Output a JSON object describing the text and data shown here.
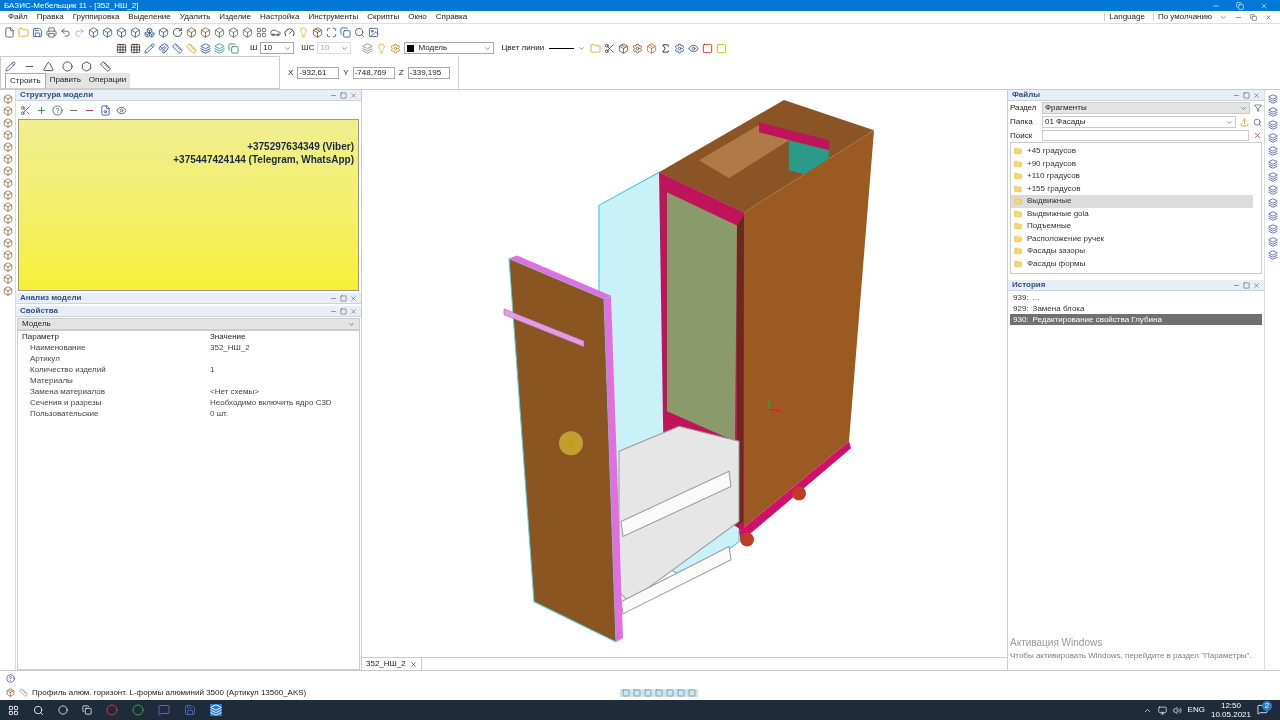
{
  "window": {
    "title": "БАЗИС-Мебельщик 11 - [352_НШ_2]"
  },
  "menu": [
    "Файл",
    "Правка",
    "Группировка",
    "Выделение",
    "Удалить",
    "Изделие",
    "Настройка",
    "Инструменты",
    "Скрипты",
    "Окно",
    "Справка"
  ],
  "menu_right": {
    "language": "Language",
    "profile": "По умолчанию"
  },
  "toolbar": {
    "width_label": "Ш",
    "width_value": "10",
    "ws_label": "ШС",
    "ws_value": "10",
    "ws_disabled": true,
    "layer": "Модель",
    "line_color_label": "Цвет линии"
  },
  "build_tabs": [
    {
      "label": "Строить",
      "selected": true
    },
    {
      "label": "Править",
      "selected": false
    },
    {
      "label": "Операции",
      "selected": false
    }
  ],
  "coords": [
    {
      "label": "X",
      "value": "-932,61"
    },
    {
      "label": "Y",
      "value": "-748,769"
    },
    {
      "label": "Z",
      "value": "-339,195"
    }
  ],
  "structure_panel": {
    "title": "Структура модели",
    "note_lines": [
      "+375297634349 (Viber)",
      "+375447424144 (Telegram, WhatsApp)"
    ]
  },
  "analysis_panel": {
    "title": "Анализ модели"
  },
  "properties": {
    "title": "Свойства",
    "object": "Модель",
    "columns": [
      "Параметр",
      "Значение"
    ],
    "rows": [
      {
        "name": "Наименование",
        "value": "352_НШ_2"
      },
      {
        "name": "Артикул"
      },
      {
        "name": "Количество изделий",
        "value": "1"
      },
      {
        "name": "Материалы"
      },
      {
        "name": "Замена материалов",
        "value": "<Нет схемы>"
      },
      {
        "name": "Сечения и разрезы",
        "value": "Необходимо включить ядро C3D"
      },
      {
        "name": "Пользовательские",
        "value": "0 шт."
      }
    ]
  },
  "files": {
    "title": "Файлы",
    "section_label": "Раздел",
    "section": "Фрагменты",
    "folder_label": "Папка",
    "folder": "01 Фасады",
    "search_label": "Поиск",
    "items": [
      {
        "label": "+45 градусов",
        "selected": false
      },
      {
        "label": "+90 градусов",
        "selected": false
      },
      {
        "label": "+110 градусов",
        "selected": false
      },
      {
        "label": "+155 градусов",
        "selected": false
      },
      {
        "label": "Выдвижные",
        "selected": true
      },
      {
        "label": "Выдвижные gola",
        "selected": false
      },
      {
        "label": "Подъемные",
        "selected": false
      },
      {
        "label": "Расположение ручек",
        "selected": false
      },
      {
        "label": "Фасады зазоры",
        "selected": false
      },
      {
        "label": "Фасады формы",
        "selected": false
      }
    ]
  },
  "history": {
    "title": "История",
    "entries": [
      {
        "number": "939:",
        "label": "...",
        "selected": false
      },
      {
        "number": "929:",
        "label": "Замена блока",
        "selected": false
      },
      {
        "number": "930:",
        "label": "Редактирование свойства Глубина",
        "selected": true
      }
    ]
  },
  "document_tab": "352_НШ_2",
  "status": "Профиль алюм. горизонт. L-формы алюминий 3500 (Артикул 13500_AKS)",
  "activation": {
    "title": "Активация Windows",
    "text": "Чтобы активировать Windows, перейдите в раздел \"Параметры\"."
  },
  "taskbar": {
    "lang": "ENG",
    "time": "12:50",
    "date": "10.05.2021",
    "notifications": "2"
  }
}
